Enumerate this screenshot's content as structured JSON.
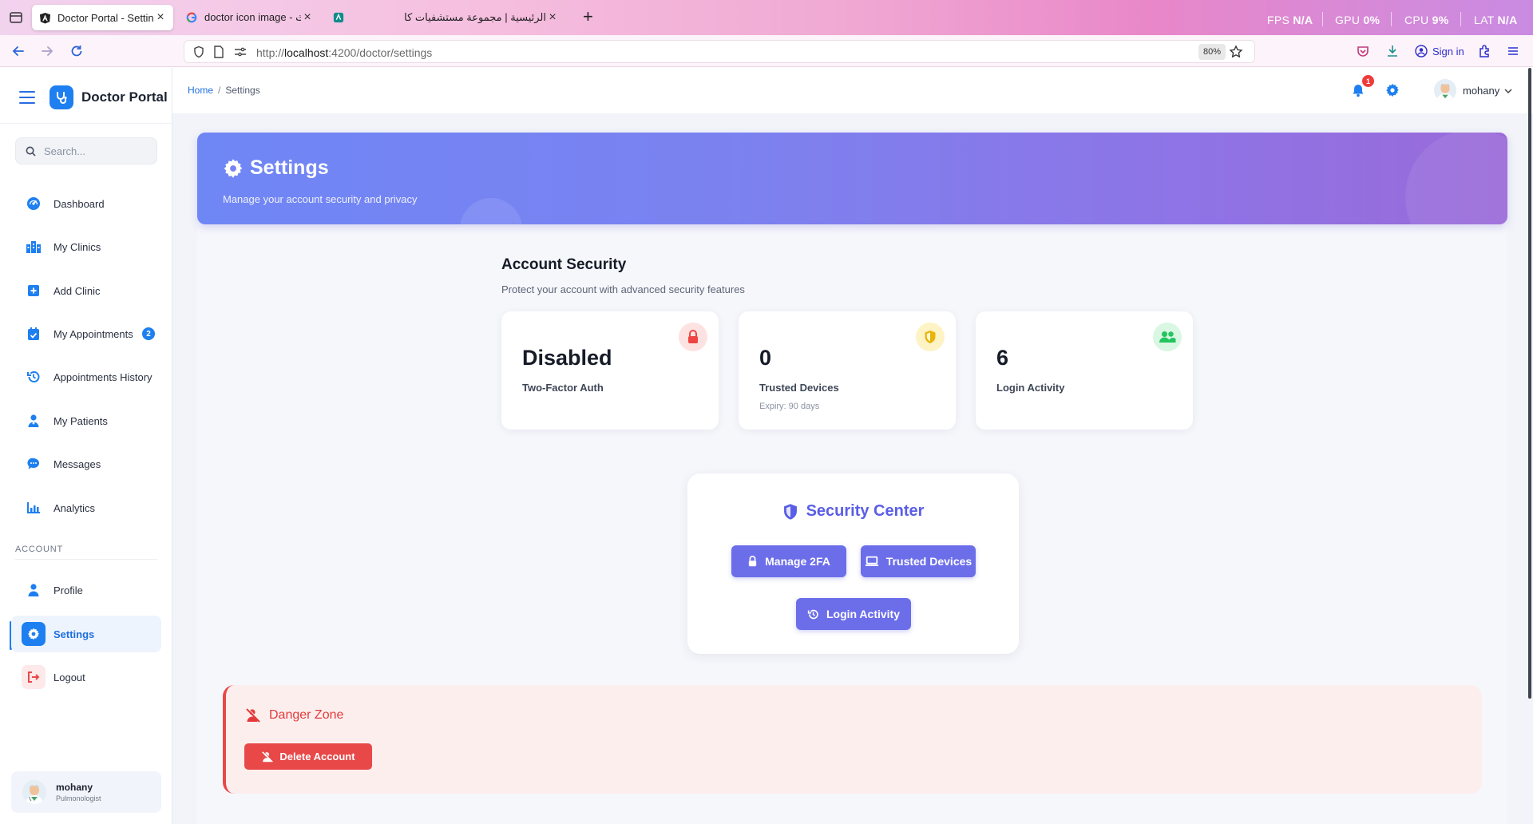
{
  "browser": {
    "tabs": [
      {
        "title": "Doctor Portal - Settings",
        "active": true
      },
      {
        "title": "doctor icon image - بحث Google",
        "active": false
      },
      {
        "title": "الرئيسية | مجموعة مستشفيات كا",
        "active": false
      }
    ],
    "perf": {
      "fps_label": "FPS",
      "fps_value": "N/A",
      "gpu_label": "GPU",
      "gpu_value": "0%",
      "cpu_label": "CPU",
      "cpu_value": "9%",
      "lat_label": "LAT",
      "lat_value": "N/A"
    },
    "url": {
      "prefix": "http://",
      "host": "localhost",
      "rest": ":4200/doctor/settings"
    },
    "zoom": "80%",
    "signin": "Sign in"
  },
  "sidebar": {
    "brand": "Doctor Portal",
    "search_placeholder": "Search...",
    "items": [
      {
        "label": "Dashboard",
        "icon": "dashboard-icon"
      },
      {
        "label": "My Clinics",
        "icon": "clinics-icon"
      },
      {
        "label": "Add Clinic",
        "icon": "add-icon"
      },
      {
        "label": "My Appointments",
        "icon": "calendar-icon",
        "badge": "2"
      },
      {
        "label": "Appointments History",
        "icon": "history-icon"
      },
      {
        "label": "My Patients",
        "icon": "patients-icon"
      },
      {
        "label": "Messages",
        "icon": "messages-icon"
      },
      {
        "label": "Analytics",
        "icon": "analytics-icon"
      }
    ],
    "account_label": "ACCOUNT",
    "account_items": [
      {
        "label": "Profile",
        "icon": "profile-icon"
      },
      {
        "label": "Settings",
        "icon": "gear-icon",
        "active": true
      },
      {
        "label": "Logout",
        "icon": "logout-icon"
      }
    ],
    "user": {
      "name": "mohany",
      "role": "Pulmonologist"
    }
  },
  "topbar": {
    "breadcrumb_home": "Home",
    "breadcrumb_sep": "/",
    "breadcrumb_current": "Settings",
    "notifications": "1",
    "user": "mohany"
  },
  "hero": {
    "title": "Settings",
    "subtitle": "Manage your account security and privacy"
  },
  "security": {
    "title": "Account Security",
    "subtitle": "Protect your account with advanced security features",
    "stats": [
      {
        "value": "Disabled",
        "label": "Two-Factor Auth",
        "note": "",
        "icon": "lock-icon",
        "color": "#ef4444"
      },
      {
        "value": "0",
        "label": "Trusted Devices",
        "note": "Expiry: 90 days",
        "icon": "shield-icon",
        "color": "#eab308"
      },
      {
        "value": "6",
        "label": "Login Activity",
        "note": "",
        "icon": "users-icon",
        "color": "#22c55e"
      }
    ]
  },
  "security_center": {
    "title": "Security Center",
    "buttons": {
      "manage_2fa": "Manage 2FA",
      "trusted_devices": "Trusted Devices",
      "login_activity": "Login Activity"
    }
  },
  "danger": {
    "title": "Danger Zone",
    "button": "Delete Account"
  },
  "colors": {
    "primary": "#1e7ff0",
    "accent": "#6c6ee9",
    "danger": "#e84848",
    "hero_start": "#6f86f5",
    "hero_end": "#9a6ad9"
  }
}
